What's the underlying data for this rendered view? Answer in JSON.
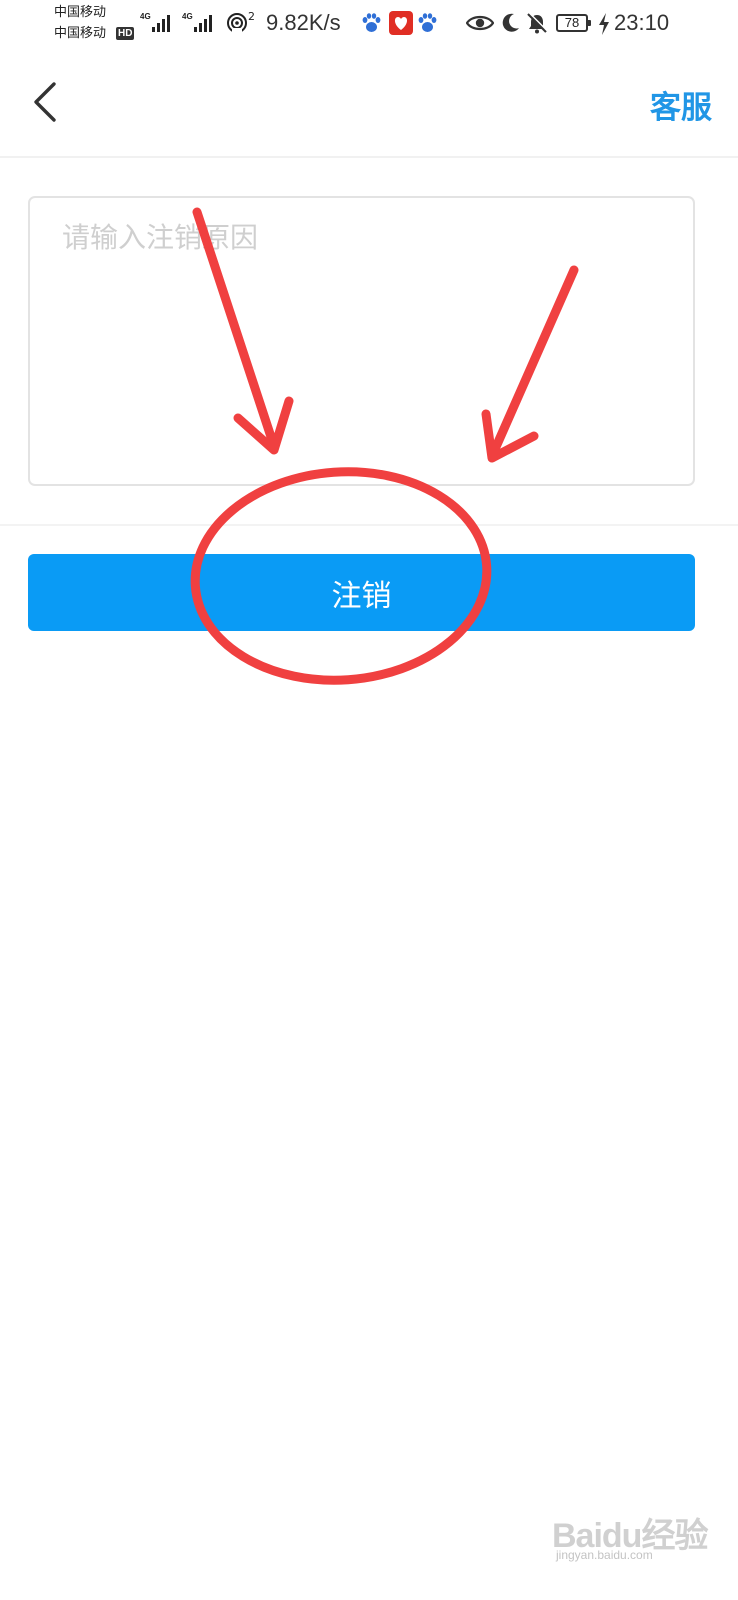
{
  "status_bar": {
    "carrier_1": "中国移动",
    "carrier_2": "中国移动",
    "hd_badge": "HD",
    "network_1": "4G",
    "network_2": "4G",
    "hotspot_count": "2",
    "net_speed": "9.82K/s",
    "battery": "78",
    "time": "23:10",
    "icons": [
      "signal-icon",
      "hotspot-icon",
      "baidu-paw-icon",
      "pinduoduo-icon",
      "eye-icon",
      "moon-icon",
      "bell-off-icon",
      "battery-icon",
      "charging-icon"
    ]
  },
  "nav": {
    "back_icon": "chevron-left-icon",
    "customer_service": "客服"
  },
  "form": {
    "reason_placeholder": "请输入注销原因",
    "reason_value": "",
    "submit_label": "注销"
  },
  "annotation": {
    "color": "#f04040",
    "shapes": [
      "arrow-left",
      "arrow-right",
      "ellipse-around-submit"
    ]
  },
  "watermark": {
    "text": "Baidu经验",
    "sub": "jingyan.baidu.com"
  },
  "colors": {
    "accent": "#0a9bf5",
    "link": "#2196e6",
    "annotation": "#f04040"
  }
}
